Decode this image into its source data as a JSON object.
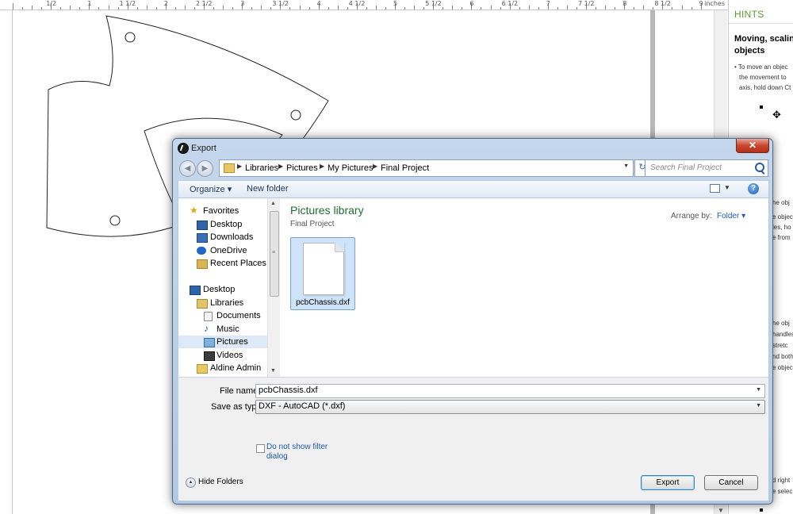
{
  "background_app": {
    "ruler": {
      "unit": "inches",
      "labels": [
        "1/2",
        "1",
        "1 1/2",
        "2",
        "2 1/2",
        "3",
        "3 1/2",
        "4",
        "4 1/2",
        "5",
        "5 1/2",
        "6",
        "6 1/2",
        "7",
        "7 1/2",
        "8",
        "8 1/2",
        "9"
      ]
    },
    "hints": {
      "header": "HINTS",
      "title_line1": "Moving, scalin",
      "title_line2": "objects",
      "bullet_line1": "• To move an objec",
      "bullet_line2": "the movement to",
      "bullet_line3": "axis, hold down Ct",
      "fragments_a": [
        "he obj",
        "e objec",
        "les, ho",
        "e from"
      ],
      "fragments_b": [
        "he obj",
        "handles",
        "stretc",
        "nd both",
        "e objec"
      ],
      "fragments_c": [
        "d right",
        "e selec"
      ]
    }
  },
  "dialog": {
    "title": "Export",
    "close_glyph": "✕",
    "nav": {
      "back_glyph": "◀",
      "forward_glyph": "▶",
      "breadcrumb": [
        "Libraries",
        "Pictures",
        "My Pictures",
        "Final Project"
      ],
      "search_placeholder": "Search Final Project"
    },
    "toolbar": {
      "organize": "Organize ▾",
      "new_folder": "New folder",
      "help_glyph": "?"
    },
    "nav_pane": {
      "favorites_header": "Favorites",
      "favorites": [
        "Desktop",
        "Downloads",
        "OneDrive",
        "Recent Places"
      ],
      "desktop_header": "Desktop",
      "libraries": "Libraries",
      "library_items": [
        "Documents",
        "Music",
        "Pictures",
        "Videos"
      ],
      "user": "Aldine Admin",
      "selected": "Pictures"
    },
    "file_area": {
      "library_title": "Pictures library",
      "library_subtitle": "Final Project",
      "arrange_by_label": "Arrange by:",
      "arrange_by_value": "Folder ▾",
      "files": [
        {
          "name": "pcbChassis.dxf",
          "icon": "blank-document-icon"
        }
      ]
    },
    "form": {
      "file_name_label": "File name:",
      "file_name_value": "pcbChassis.dxf",
      "save_as_label": "Save as type:",
      "save_as_value": "DXF - AutoCAD (*.dxf)",
      "checkbox_line1": "Do not show filter",
      "checkbox_line2": "dialog",
      "checkbox_checked": false,
      "hide_folders": "Hide Folders",
      "export_button": "Export",
      "cancel_button": "Cancel"
    }
  }
}
